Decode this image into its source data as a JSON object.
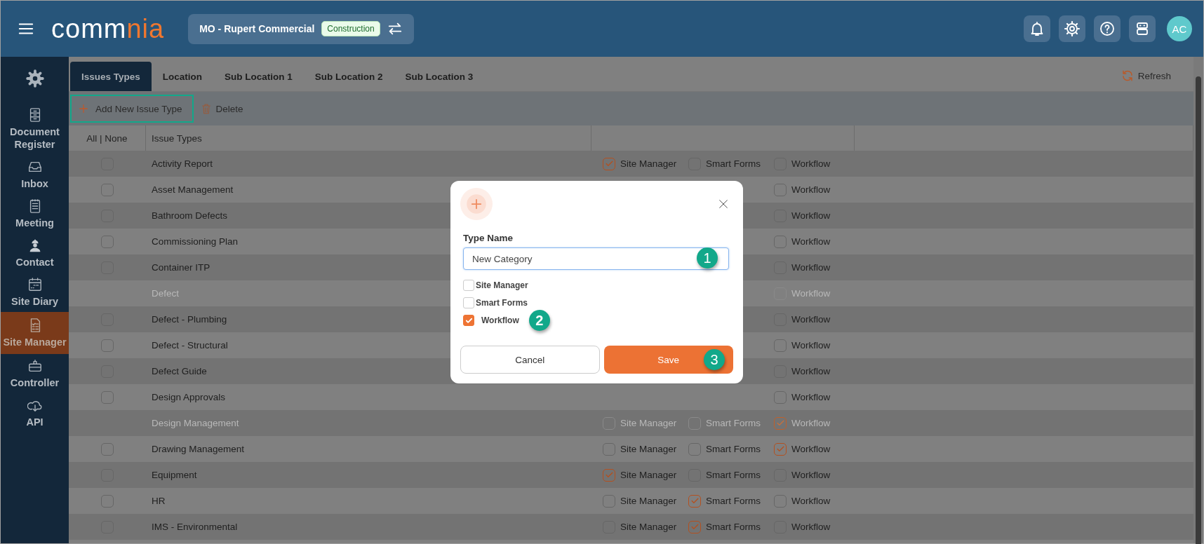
{
  "header": {
    "logo_main": "comm",
    "logo_accent": "nia",
    "project": {
      "name": "MO - Rupert Commercial",
      "badge": "Construction"
    },
    "avatar": "AC"
  },
  "sidebar": {
    "items": [
      {
        "label": "Document Register",
        "selected": false
      },
      {
        "label": "Inbox",
        "selected": false
      },
      {
        "label": "Meeting",
        "selected": false
      },
      {
        "label": "Contact",
        "selected": false
      },
      {
        "label": "Site Diary",
        "selected": false
      },
      {
        "label": "Site Manager",
        "selected": true
      },
      {
        "label": "Controller",
        "selected": false
      },
      {
        "label": "API",
        "selected": false
      }
    ]
  },
  "tabs": [
    {
      "label": "Issues Types",
      "selected": true
    },
    {
      "label": "Location",
      "selected": false
    },
    {
      "label": "Sub Location 1",
      "selected": false
    },
    {
      "label": "Sub Location 2",
      "selected": false
    },
    {
      "label": "Sub Location 3",
      "selected": false
    }
  ],
  "refresh": "Refresh",
  "toolbar": {
    "add_button": {
      "label": "Add New Issue Type",
      "highlighted": true
    },
    "delete_button": "Delete"
  },
  "table": {
    "columns": [
      "All | None",
      "Issue Types"
    ],
    "rows": [
      {
        "name": "Activity Report",
        "disabled": false,
        "selected": false,
        "options": [
          {
            "kind": "site_manager",
            "label": "Site Manager",
            "checked": true
          },
          {
            "kind": "smart_forms",
            "label": "Smart Forms",
            "checked": false
          },
          {
            "kind": "workflow",
            "label": "Workflow",
            "checked": false
          }
        ]
      },
      {
        "name": "Asset Management",
        "disabled": false,
        "selected": false,
        "options": [
          {
            "kind": "workflow",
            "label": "Workflow",
            "checked": false
          }
        ]
      },
      {
        "name": "Bathroom Defects",
        "disabled": false,
        "selected": false,
        "options": [
          {
            "kind": "workflow",
            "label": "Workflow",
            "checked": false
          }
        ]
      },
      {
        "name": "Commissioning Plan",
        "disabled": false,
        "selected": false,
        "options": [
          {
            "kind": "workflow",
            "label": "Workflow",
            "checked": false
          }
        ]
      },
      {
        "name": "Container ITP",
        "disabled": false,
        "selected": false,
        "options": [
          {
            "kind": "workflow",
            "label": "Workflow",
            "checked": false
          }
        ]
      },
      {
        "name": "Defect",
        "disabled": true,
        "options": [
          {
            "kind": "workflow",
            "label": "Workflow",
            "checked": false
          }
        ]
      },
      {
        "name": "Defect - Plumbing",
        "disabled": false,
        "selected": false,
        "options": [
          {
            "kind": "workflow",
            "label": "Workflow",
            "checked": false
          }
        ]
      },
      {
        "name": "Defect - Structural",
        "disabled": false,
        "selected": false,
        "options": [
          {
            "kind": "workflow",
            "label": "Workflow",
            "checked": false
          }
        ]
      },
      {
        "name": "Defect Guide",
        "disabled": false,
        "selected": false,
        "options": [
          {
            "kind": "workflow",
            "label": "Workflow",
            "checked": false
          }
        ]
      },
      {
        "name": "Design Approvals",
        "disabled": false,
        "selected": false,
        "options": [
          {
            "kind": "workflow",
            "label": "Workflow",
            "checked": false
          }
        ]
      },
      {
        "name": "Design Management",
        "disabled": true,
        "options": [
          {
            "kind": "site_manager",
            "label": "Site Manager",
            "checked": false
          },
          {
            "kind": "smart_forms",
            "label": "Smart Forms",
            "checked": false
          },
          {
            "kind": "workflow",
            "label": "Workflow",
            "checked": true
          }
        ]
      },
      {
        "name": "Drawing Management",
        "disabled": false,
        "selected": false,
        "options": [
          {
            "kind": "site_manager",
            "label": "Site Manager",
            "checked": false
          },
          {
            "kind": "smart_forms",
            "label": "Smart Forms",
            "checked": false
          },
          {
            "kind": "workflow",
            "label": "Workflow",
            "checked": true
          }
        ]
      },
      {
        "name": "Equipment",
        "disabled": false,
        "selected": false,
        "options": [
          {
            "kind": "site_manager",
            "label": "Site Manager",
            "checked": true
          },
          {
            "kind": "smart_forms",
            "label": "Smart Forms",
            "checked": false
          },
          {
            "kind": "workflow",
            "label": "Workflow",
            "checked": false
          }
        ]
      },
      {
        "name": "HR",
        "disabled": false,
        "selected": false,
        "options": [
          {
            "kind": "site_manager",
            "label": "Site Manager",
            "checked": false
          },
          {
            "kind": "smart_forms",
            "label": "Smart Forms",
            "checked": true
          },
          {
            "kind": "workflow",
            "label": "Workflow",
            "checked": false
          }
        ]
      },
      {
        "name": "IMS - Environmental",
        "disabled": false,
        "selected": false,
        "options": [
          {
            "kind": "site_manager",
            "label": "Site Manager",
            "checked": false
          },
          {
            "kind": "smart_forms",
            "label": "Smart Forms",
            "checked": true
          },
          {
            "kind": "workflow",
            "label": "Workflow",
            "checked": false
          }
        ]
      }
    ]
  },
  "dialog": {
    "field_label": "Type Name",
    "field_value": "New Category",
    "field_badge": "1",
    "options": [
      {
        "label": "Site Manager",
        "checked": false
      },
      {
        "label": "Smart Forms",
        "checked": false
      },
      {
        "label": "Workflow",
        "checked": true,
        "badge": "2"
      }
    ],
    "cancel": "Cancel",
    "save": "Save",
    "save_badge": "3"
  }
}
